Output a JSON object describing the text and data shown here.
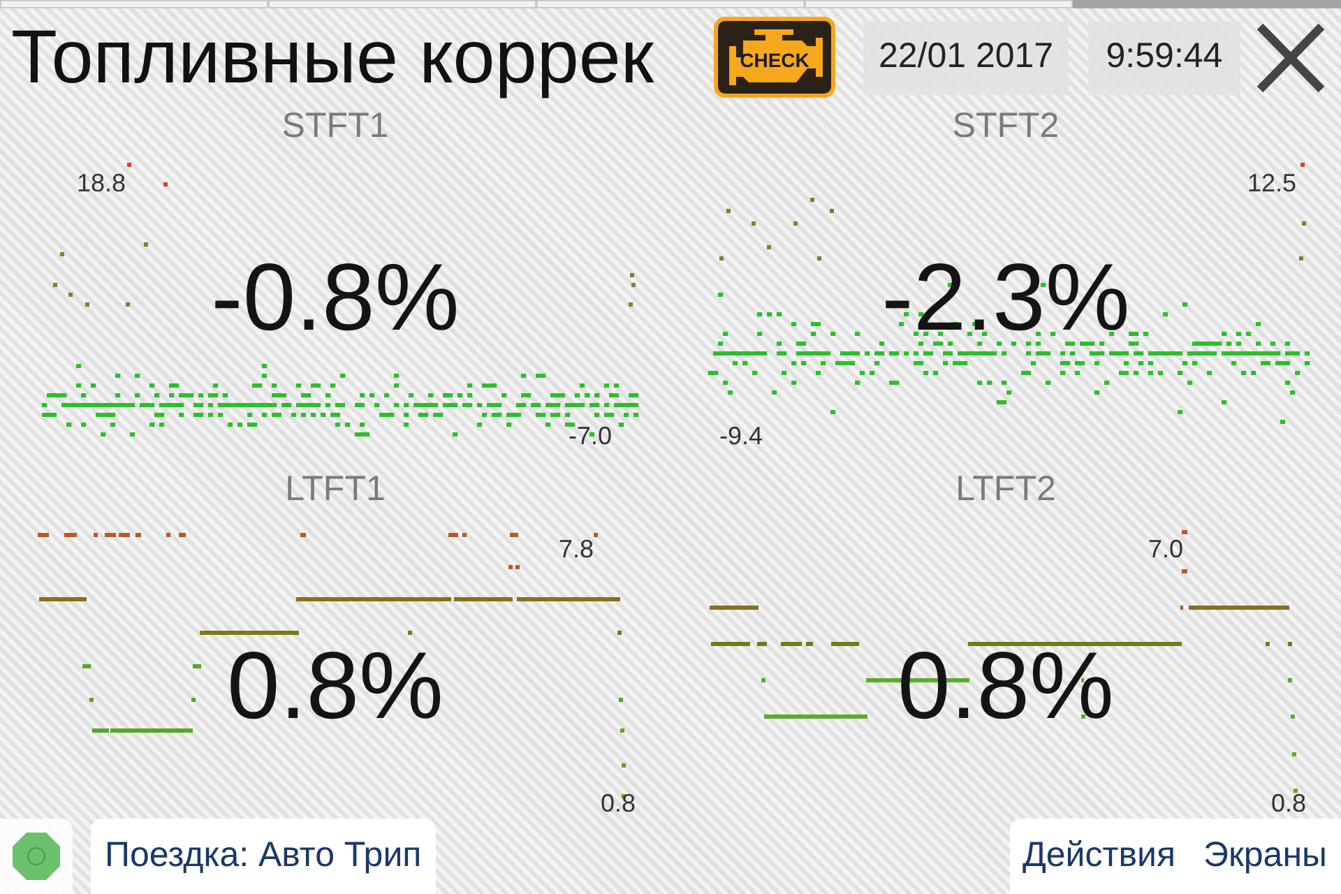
{
  "pager": [
    {
      "selected": false
    },
    {
      "selected": false
    },
    {
      "selected": false
    },
    {
      "selected": false
    },
    {
      "selected": true
    }
  ],
  "header": {
    "title": "Топливные коррек",
    "check_engine": "CHECK",
    "date": "22/01 2017",
    "time": "9:59:44"
  },
  "gauges": [
    {
      "kind": "scatter",
      "name": "STFT1",
      "value": "-0.8%",
      "max": "18.8",
      "min": "-7.0"
    },
    {
      "kind": "scatter",
      "name": "STFT2",
      "value": "-2.3%",
      "max": "12.5",
      "min": "-9.4"
    },
    {
      "kind": "steps",
      "name": "LTFT1",
      "value": "0.8%",
      "max": "7.8",
      "min": "0.8"
    },
    {
      "kind": "steps",
      "name": "LTFT2",
      "value": "0.8%",
      "max": "7.0",
      "min": "0.8"
    }
  ],
  "footer": {
    "connected": true,
    "trip": "Поездка: Авто Трип",
    "actions": [
      "Действия",
      "Экраны"
    ]
  }
}
